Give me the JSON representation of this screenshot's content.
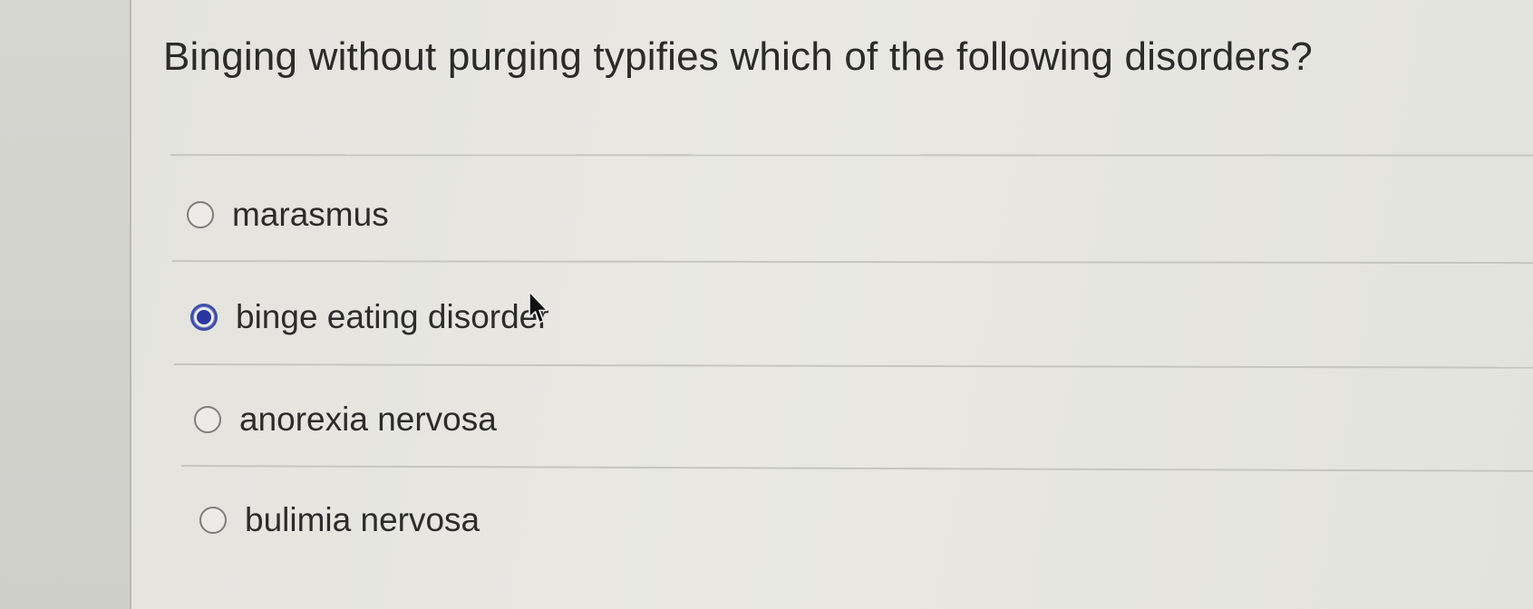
{
  "question": {
    "text": "Binging without purging typifies which of the following disorders?"
  },
  "options": [
    {
      "label": "marasmus",
      "selected": false
    },
    {
      "label": "binge eating disorder",
      "selected": true
    },
    {
      "label": "anorexia nervosa",
      "selected": false
    },
    {
      "label": "bulimia nervosa",
      "selected": false
    }
  ],
  "colors": {
    "selected_radio": "#2a35a0",
    "text": "#2c2c2c",
    "background": "#e6e5e0"
  },
  "icons": {
    "cursor": "mouse-pointer-icon"
  }
}
